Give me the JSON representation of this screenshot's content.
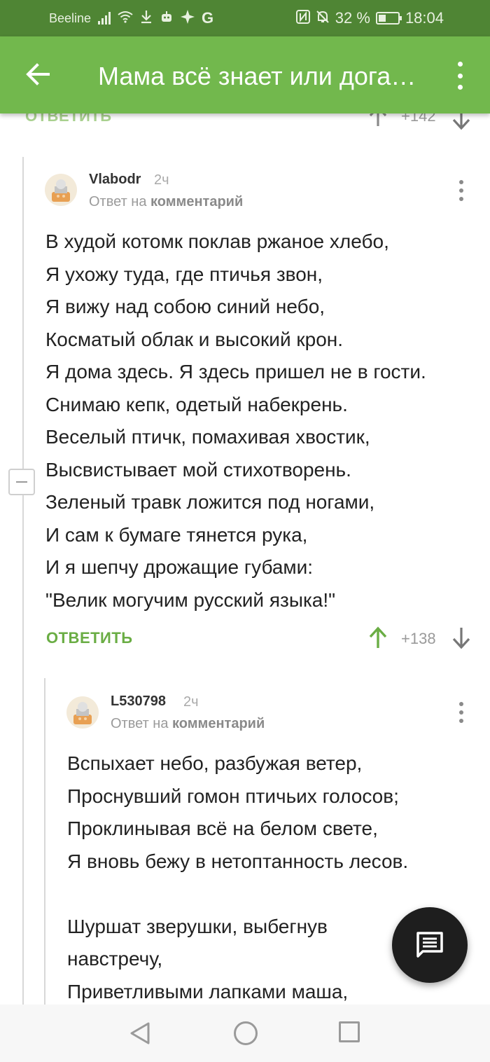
{
  "status_bar": {
    "carrier": "Beeline",
    "battery_percent": "32 %",
    "time": "18:04",
    "icons": [
      "signal-icon",
      "wifi-icon",
      "download-icon",
      "robot-icon",
      "sparkle-icon",
      "google-g-icon",
      "nfc-icon",
      "bell-off-icon",
      "battery-icon"
    ]
  },
  "app_bar": {
    "title": "Мама всё знает или догадывается"
  },
  "top_comment_footer": {
    "reply_label": "ОТВЕТИТЬ",
    "rating": "+142"
  },
  "comment1": {
    "username": "Vlabodr",
    "time": "2ч",
    "reply_prefix": "Ответ на",
    "reply_target": "комментарий",
    "lines": [
      "В худой котомк поклав ржаное хлебо,",
      "Я ухожу туда, где птичья звон,",
      "Я вижу над собою синий небо,",
      "Косматый облак и высокий крон.",
      "Я дома здесь. Я здесь пришел не в гости.",
      "Снимаю кепк, одетый набекрень.",
      "Веселый птичк, помахивая хвостик,",
      "Высвистывает мой стихотворень.",
      "Зеленый травк ложится под ногами,",
      "И сам к бумаге тянется рука,",
      "И я шепчу дрожащие губами:",
      "\"Велик могучим русский языка!\""
    ],
    "reply_label": "ОТВЕТИТЬ",
    "rating": "+138"
  },
  "comment2": {
    "username": "L530798",
    "time": "2ч",
    "reply_prefix": "Ответ на",
    "reply_target": "комментарий",
    "lines": [
      "Вспыхает небо, разбужая ветер,",
      "Проснувший гомон птичьих голосов;",
      "Проклинывая всё на белом свете,",
      "Я вновь бежу в нетоптанность лесов.",
      "",
      "Шуршат зверушки, выбегнув",
      "навстречу,",
      "Приветливыми лапками маша,"
    ]
  },
  "colors": {
    "status_bar": "#4f8534",
    "app_bar": "#72b84d",
    "accent": "#6aad44",
    "fab": "#1e1e1e"
  }
}
